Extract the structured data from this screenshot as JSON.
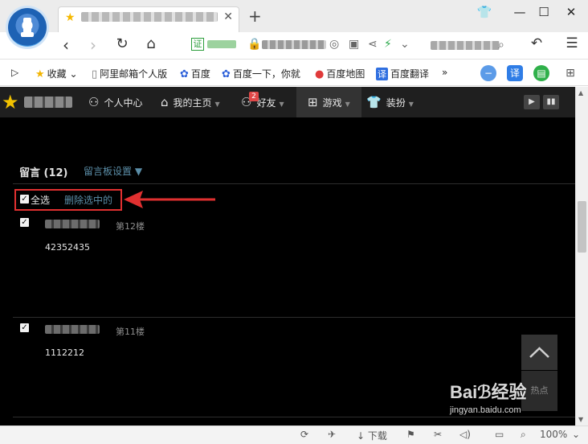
{
  "tab": {
    "title": "■ ■■■ ■■■ ■■■■ ■■■■■ ■■■",
    "close_icon": "close-icon"
  },
  "address_bar": {
    "security_label": "证",
    "security_text": "■■■■■",
    "url": "■■■■■■■■■",
    "search_text": "■■■■■■■■■■"
  },
  "bookmarks": [
    {
      "label": "收藏",
      "icon": "star-icon"
    },
    {
      "label": "阿里邮箱个人版",
      "icon": "page-icon"
    },
    {
      "label": "百度",
      "icon": "baidu-paw-icon"
    },
    {
      "label": "百度一下，你就",
      "icon": "baidu-paw-icon"
    },
    {
      "label": "百度地图",
      "icon": "map-pin-icon"
    },
    {
      "label": "百度翻译",
      "icon": "translate-icon"
    }
  ],
  "bookmarks_more": "»",
  "extensions": {
    "translate_label": "译"
  },
  "site_nav": {
    "user_name": "■■■■■■",
    "items": [
      {
        "label": "个人中心"
      },
      {
        "label": "我的主页"
      },
      {
        "label": "好友",
        "badge": "2"
      },
      {
        "label": "游戏"
      },
      {
        "label": "装扮"
      }
    ]
  },
  "messages": {
    "title": "留言 (12)",
    "settings_link": "留言板设置 ▼",
    "select_all": "全选",
    "delete_selected": "删除选中的",
    "items": [
      {
        "author": "■■■■■■",
        "floor": "第12楼",
        "body": "42352435",
        "checked": true
      },
      {
        "author": "■■■■■■",
        "floor": "第11楼",
        "body": "1112212",
        "checked": true
      }
    ]
  },
  "side_buttons": {
    "hot_label": "热点"
  },
  "watermark": {
    "main": "Baiℬ经验",
    "sub": "jingyan.baidu.com"
  },
  "status_bar": {
    "download_label": "下载",
    "zoom": "100%"
  },
  "colors": {
    "accent_link": "#5b8ea8",
    "highlight": "#e03030",
    "page_bg": "#000000"
  }
}
